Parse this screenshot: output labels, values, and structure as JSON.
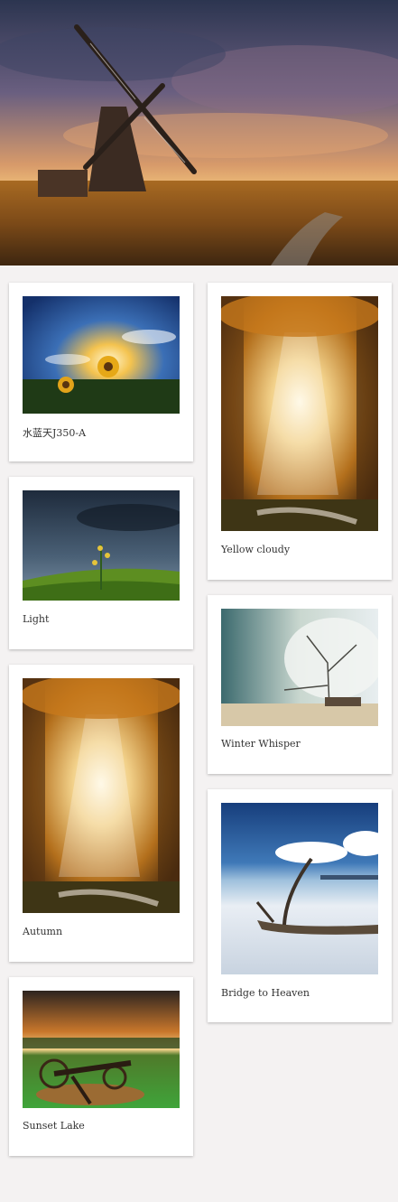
{
  "hero": {
    "image": "windmill-sunset-image"
  },
  "cards": [
    {
      "caption": "水蓝天J350-A",
      "image": "sunflower-sunburst-image"
    },
    {
      "caption": "Yellow cloudy",
      "image": "golden-forest-light-image"
    },
    {
      "caption": "Light",
      "image": "stormy-sky-plant-image"
    },
    {
      "caption": "Winter Whisper",
      "image": "winter-tree-image"
    },
    {
      "caption": "Autumn",
      "image": "autumn-forest-rays-image"
    },
    {
      "caption": "Bridge to Heaven",
      "image": "driftwood-beach-image"
    },
    {
      "caption": "Sunset Lake",
      "image": "cannon-sunset-image"
    }
  ],
  "colors": {
    "background": "#f4f2f2",
    "card": "#ffffff",
    "caption_text": "#333333"
  }
}
